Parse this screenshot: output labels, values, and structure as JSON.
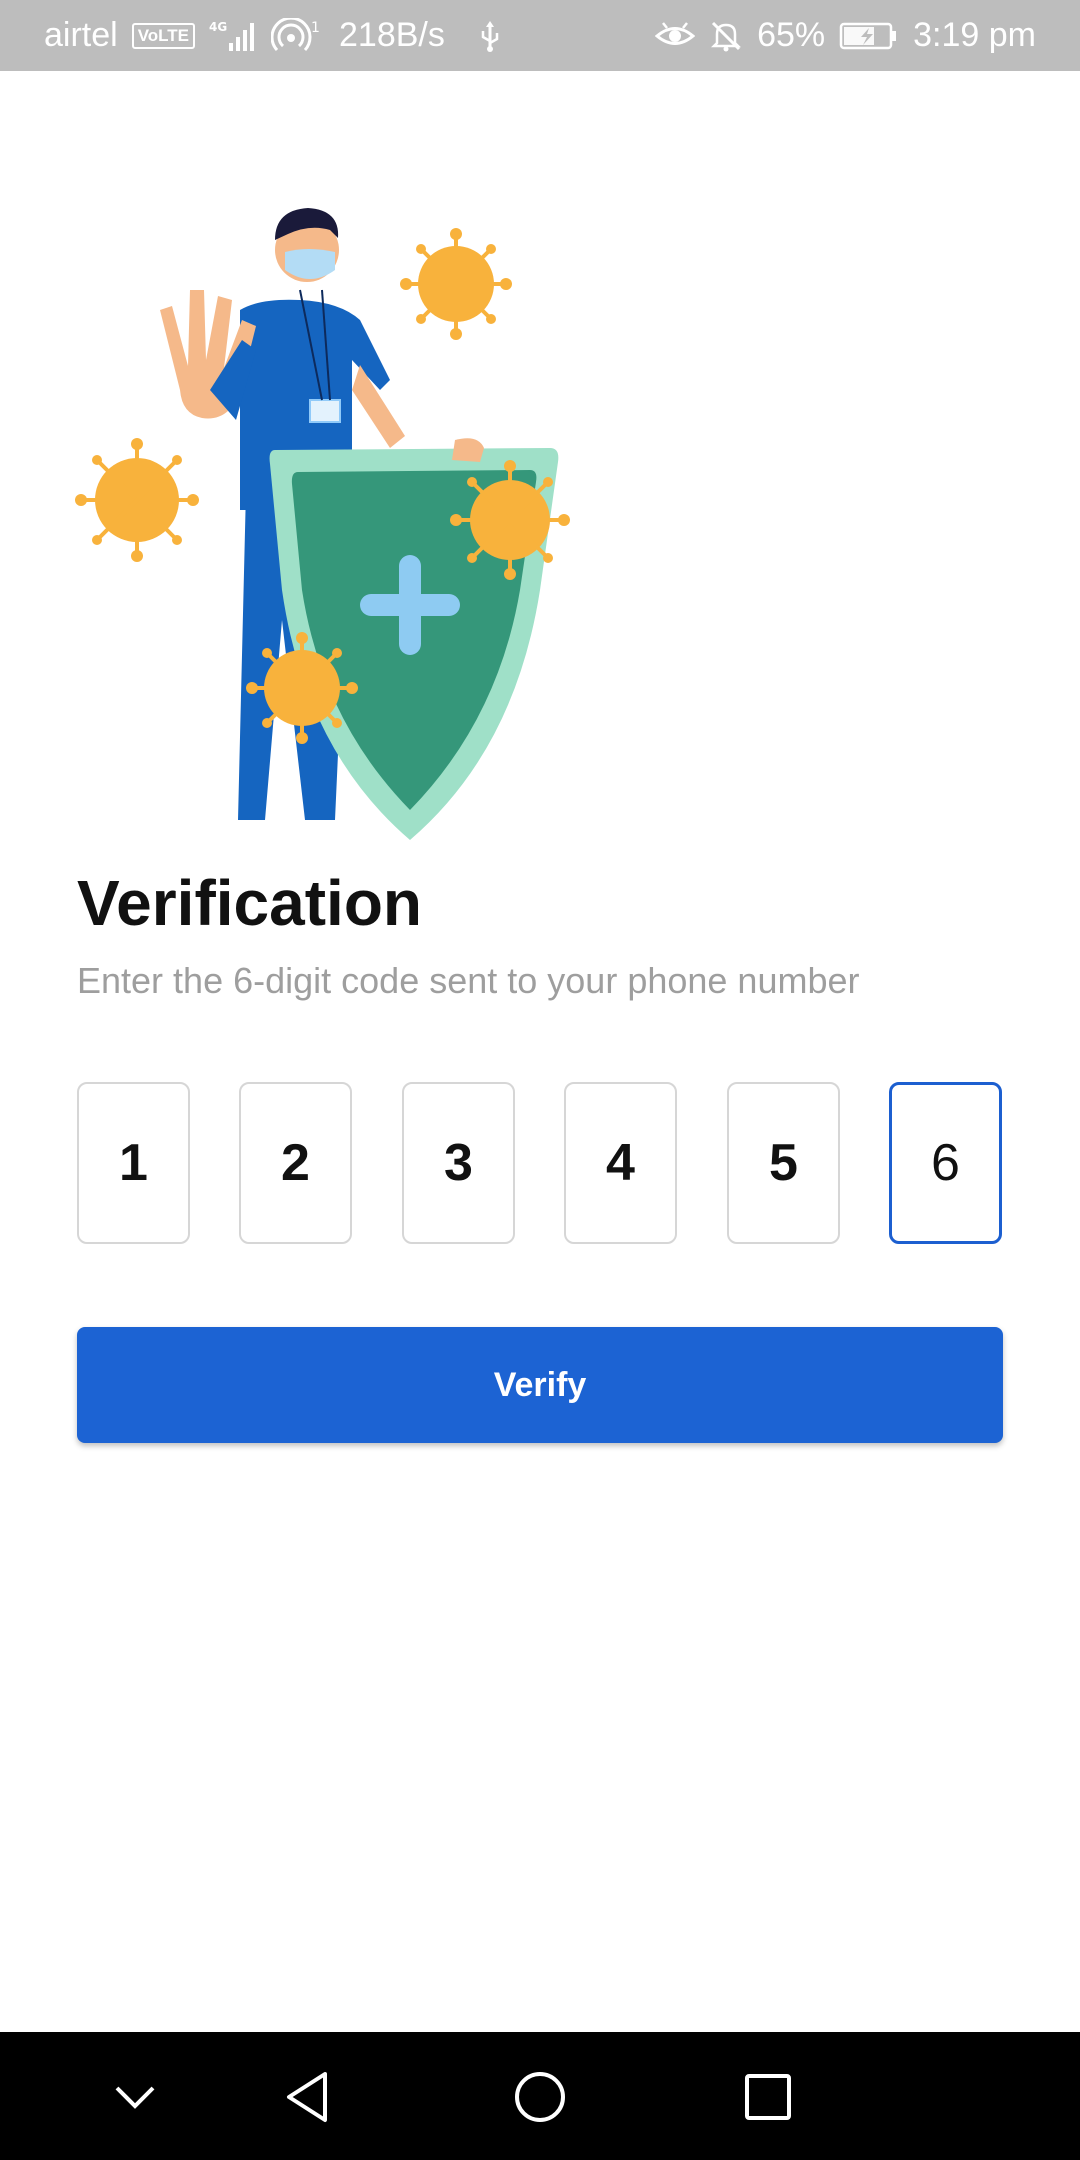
{
  "status_bar": {
    "carrier": "airtel",
    "volte": "VoLTE",
    "network": "4G",
    "hotspot_count": "1",
    "speed": "218B/s",
    "battery": "65%",
    "time": "3:19 pm",
    "icons": [
      "volte-icon",
      "signal-icon",
      "hotspot-icon",
      "usb-icon",
      "eye-icon",
      "bell-off-icon",
      "battery-charging-icon"
    ]
  },
  "illustration": {
    "name": "doctor-with-shield-illustration",
    "colors": {
      "shield_outer": "#9fe0c8",
      "shield_inner": "#35977a",
      "cross": "#8ecbf2",
      "virus": "#f8b23c",
      "scrubs": "#1565c0",
      "skin": "#f5b98a"
    }
  },
  "title": "Verification",
  "subtitle": "Enter the 6-digit code sent to your phone number",
  "otp": {
    "digits": [
      "1",
      "2",
      "3",
      "4",
      "5",
      "6"
    ],
    "active_index": 5
  },
  "verify_button": {
    "label": "Verify"
  },
  "nav_bar": {
    "buttons": [
      "chevron-down-icon",
      "back-icon",
      "home-icon",
      "recents-icon"
    ]
  },
  "colors": {
    "accent": "#1c63d3",
    "title": "#111111",
    "subtitle": "#9e9e9e",
    "status_bar": "#bdbdbd"
  }
}
